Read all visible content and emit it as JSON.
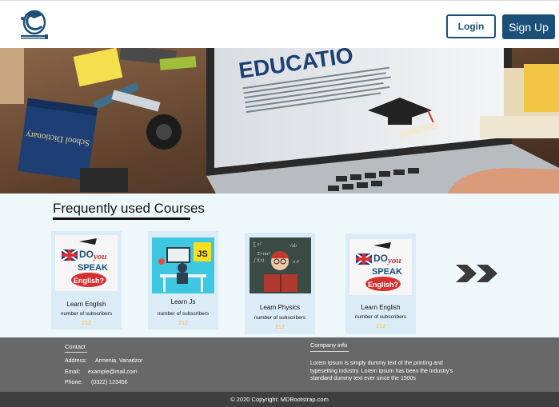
{
  "header": {
    "logo_icon": "graduation-cap-logo-icon",
    "login_label": "Login",
    "signup_label": "Sign Up",
    "accent_color": "#1c4f78"
  },
  "hero": {
    "image": "laptop-with-education-page-photo",
    "screen_heading": "EDUCATIO",
    "book_title": "School Dictionary"
  },
  "courses": {
    "title": "Frequently used Courses",
    "items": [
      {
        "name": "Learn English",
        "subscribers_label": "number of subscribers",
        "count": "212",
        "image": "do-you-speak-english-image"
      },
      {
        "name": "Learn Js",
        "subscribers_label": "number of subscribers",
        "count": "212",
        "image": "javascript-developer-illustration"
      },
      {
        "name": "Learn Physics",
        "subscribers_label": "number of subscribers",
        "count": "212",
        "image": "child-reading-physics-image"
      },
      {
        "name": "Learn English",
        "subscribers_label": "number of subscribers",
        "count": "212",
        "image": "do-you-speak-english-image"
      }
    ],
    "next_icon": "double-chevron-right-icon"
  },
  "footer": {
    "contact_heading": "Contact",
    "address_label": "Address:",
    "address_value": "Armenia, Vanadzor",
    "email_label": "Email:",
    "email_value": "example@mail.com",
    "phone_label": "Phone:",
    "phone_value": "(0322) 123456",
    "info_heading": "Company info",
    "info_text": "Lorem Ipsum is simply dummy text of the printing and typesetting industry. Lorem Ipsum has been the industry's standard dummy text ever since the 1500s",
    "copyright": "© 2020 Copyright: MDBootstrap.com"
  }
}
